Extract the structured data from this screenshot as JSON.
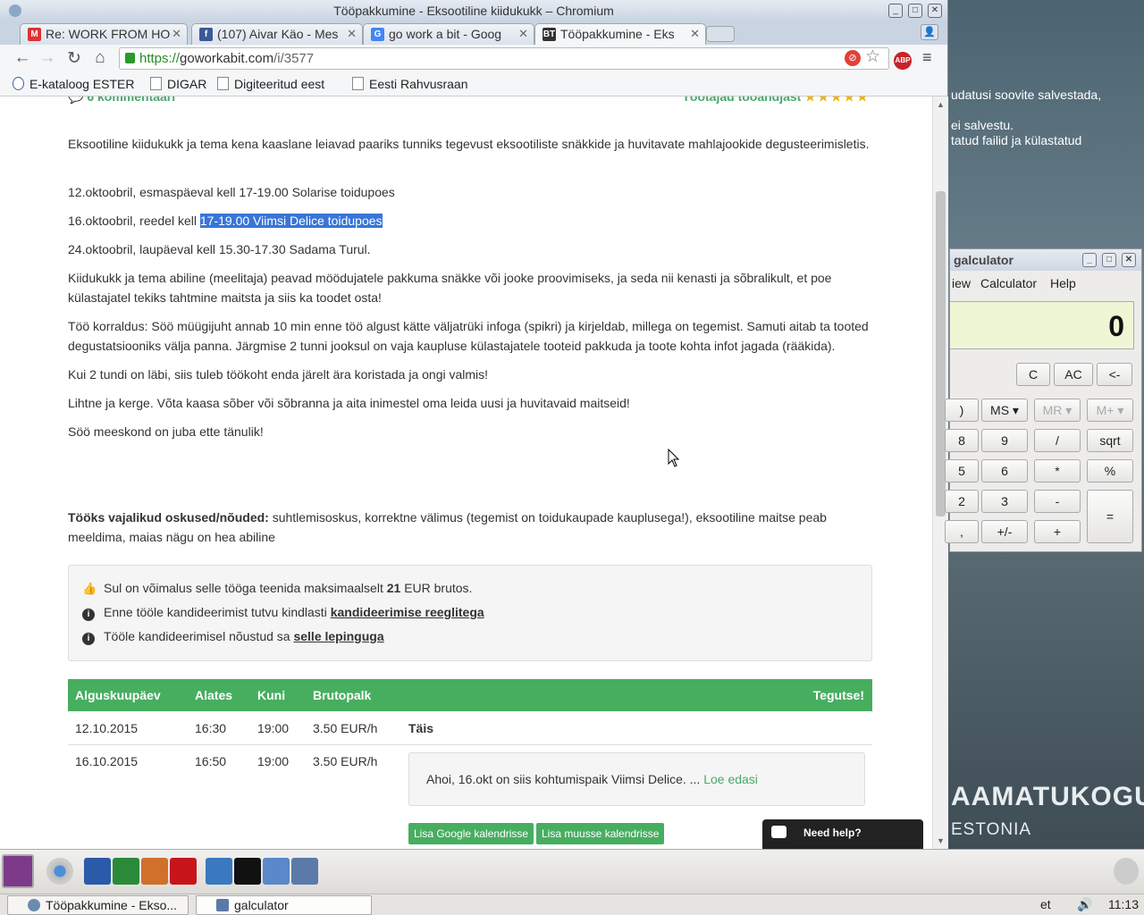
{
  "window": {
    "title": "Tööpakkumine - Eksootiline kiidukukk – Chromium"
  },
  "tabs": [
    {
      "label": "Re: WORK FROM HO",
      "icon": "gmail-icon"
    },
    {
      "label": "(107) Aivar Käo - Mes",
      "icon": "facebook-icon"
    },
    {
      "label": "go work a bit - Goog",
      "icon": "google-icon"
    },
    {
      "label": "Tööpakkumine - Eks",
      "icon": "gowork-icon",
      "active": true
    }
  ],
  "omnibox": {
    "scheme": "https://",
    "host": "goworkabit.com",
    "path": "/i/3577"
  },
  "abp": {
    "label": "ABP",
    "count": "1"
  },
  "bookmarks": [
    "E-kataloog ESTER",
    "DIGAR",
    "Digiteeritud eest",
    "Eesti Rahvusraan"
  ],
  "page": {
    "comments_label": "6 kommentaari",
    "rating_label": "Töötajad tööandjast",
    "rating_stars": 5,
    "paragraphs": [
      "Eksootiline kiidukukk ja tema kena kaaslane leiavad paariks tunniks tegevust eksootiliste snäkkide ja huvitavate mahlajookide degusteerimisletis.",
      "12.oktoobril, esmaspäeval kell 17-19.00 Solarise toidupoes",
      "24.oktoobril, laupäeval kell 15.30-17.30 Sadama Turul.",
      "Kiidukukk ja tema abiline (meelitaja) peavad möödujatele pakkuma snäkke või jooke proovimiseks, ja seda nii kenasti ja sõbralikult, et poe külastajatel tekiks tahtmine maitsta ja siis ka toodet osta!",
      "Töö korraldus: Söö müügijuht annab 10 min enne töö algust kätte väljatrüki infoga (spikri) ja kirjeldab, millega on tegemist. Samuti aitab ta tooted degustatsiooniks välja panna. Järgmise 2 tunni jooksul on vaja kaupluse külastajatele tooteid pakkuda ja toote kohta infot jagada (rääkida).",
      "Kui 2 tundi on läbi, siis tuleb töökoht enda järelt ära koristada ja ongi valmis!",
      "Lihtne ja kerge. Võta kaasa sõber või sõbranna ja aita inimestel oma leida uusi ja huvitavaid maitseid!",
      "Söö meeskond on juba ette tänulik!"
    ],
    "p_second_prefix": "16.oktoobril, reedel kell ",
    "p_second_highlight": "17-19.00 Viimsi Delice toidupoes",
    "skills_label": "Tööks vajalikud oskused/nõuded:",
    "skills_text": " suhtlemisoskus, korrektne välimus (tegemist on toidukaupade kauplusega!), eksootiline maitse peab meeldima, maias nägu on hea abiline",
    "info": {
      "earn_prefix": "Sul on võimalus selle tööga teenida maksimaalselt ",
      "earn_amount": "21",
      "earn_suffix": " EUR brutos.",
      "rules_prefix": "Enne tööle kandideerimist tutvu kindlasti ",
      "rules_link": "kandideerimise reeglitega",
      "contract_prefix": "Tööle kandideerimisel nõustud sa ",
      "contract_link": "selle lepinguga"
    },
    "shifts": {
      "headers": {
        "start": "Alguskuupäev",
        "from": "Alates",
        "to": "Kuni",
        "pay": "Brutopalk",
        "action": "Tegutse!"
      },
      "rows": [
        {
          "date": "12.10.2015",
          "from": "16:30",
          "to": "19:00",
          "pay": "3.50 EUR/h",
          "status": "Täis"
        },
        {
          "date": "16.10.2015",
          "from": "16:50",
          "to": "19:00",
          "pay": "3.50 EUR/h"
        }
      ],
      "message": "Ahoi,  16.okt on siis kohtumispaik Viimsi Delice. ... ",
      "read_more": "Loe edasi",
      "google_cal": "Lisa Google kalendrisse",
      "other_cal": "Lisa muusse kalendrisse"
    },
    "need_help": "Need help?"
  },
  "desktop": {
    "notice": [
      "udatusi soovite salvestada,",
      "",
      "ei salvestu.",
      "tatud failid ja külastatud"
    ],
    "brand1": "AAMATUKOGU",
    "brand2": "ESTONIA"
  },
  "calculator": {
    "title": "galculator",
    "menu": [
      "iew",
      "Calculator",
      "Help"
    ],
    "display": "0",
    "buttons": {
      "c": "C",
      "ac": "AC",
      "back": "<-",
      "paren": ")",
      "ms": "MS ▾",
      "mr": "MR ▾",
      "mplus": "M+ ▾",
      "n8": "8",
      "n9": "9",
      "div": "/",
      "sqrt": "sqrt",
      "n5": "5",
      "n6": "6",
      "mul": "*",
      "pct": "%",
      "n2": "2",
      "n3": "3",
      "sub": "-",
      "eq": "=",
      "dot": ",",
      "sign": "+/-",
      "add": "+"
    }
  },
  "taskbar": {
    "windows": [
      "Tööpakkumine - Ekso...",
      "galculator"
    ],
    "lang": "et",
    "time": "11:13"
  }
}
